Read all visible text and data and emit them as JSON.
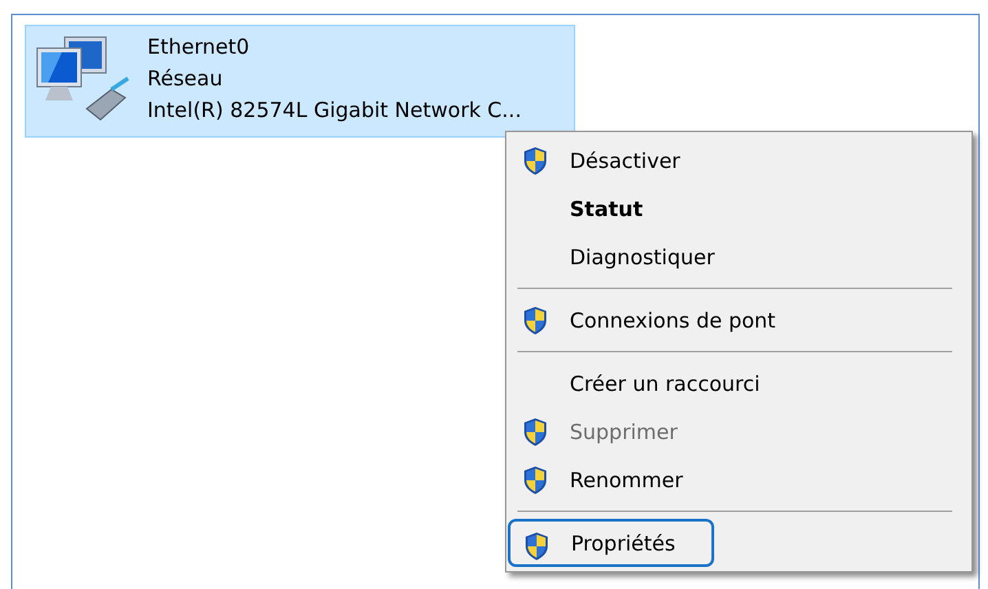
{
  "adapter": {
    "name": "Ethernet0",
    "network": "Réseau",
    "device": "Intel(R) 82574L Gigabit Network C...",
    "selected": true
  },
  "context_menu": {
    "items": [
      {
        "kind": "item",
        "label": "Désactiver",
        "shield": true,
        "bold": false,
        "disabled": false,
        "highlighted": false
      },
      {
        "kind": "item",
        "label": "Statut",
        "shield": false,
        "bold": true,
        "disabled": false,
        "highlighted": false
      },
      {
        "kind": "item",
        "label": "Diagnostiquer",
        "shield": false,
        "bold": false,
        "disabled": false,
        "highlighted": false
      },
      {
        "kind": "separator"
      },
      {
        "kind": "item",
        "label": "Connexions de pont",
        "shield": true,
        "bold": false,
        "disabled": false,
        "highlighted": false
      },
      {
        "kind": "separator"
      },
      {
        "kind": "item",
        "label": "Créer un raccourci",
        "shield": false,
        "bold": false,
        "disabled": false,
        "highlighted": false
      },
      {
        "kind": "item",
        "label": "Supprimer",
        "shield": true,
        "bold": false,
        "disabled": true,
        "highlighted": false
      },
      {
        "kind": "item",
        "label": "Renommer",
        "shield": true,
        "bold": false,
        "disabled": false,
        "highlighted": false
      },
      {
        "kind": "separator"
      },
      {
        "kind": "item",
        "label": "Propriétés",
        "shield": true,
        "bold": false,
        "disabled": false,
        "highlighted": true
      }
    ]
  }
}
